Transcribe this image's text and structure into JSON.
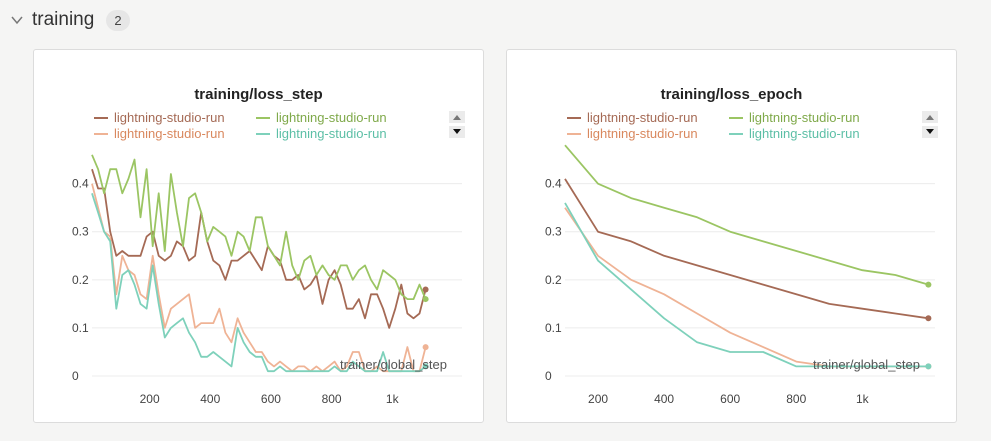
{
  "section": {
    "title": "training",
    "count": "2"
  },
  "colors": {
    "brown": "#a56a55",
    "green": "#9bc563",
    "peach": "#efb395",
    "teal": "#7ed1bb",
    "grid": "#ececec",
    "text": "#444444"
  },
  "chart_data": [
    {
      "type": "line",
      "title": "training/loss_step",
      "xlabel": "trainer/global_step",
      "xlim": [
        10,
        1230
      ],
      "ylim": [
        0,
        0.47
      ],
      "xticks": [
        200,
        400,
        600,
        800,
        1000
      ],
      "xtick_labels": [
        "200",
        "400",
        "600",
        "800",
        "1k"
      ],
      "yticks": [
        0,
        0.1,
        0.2,
        0.3,
        0.4
      ],
      "ytick_labels": [
        "0",
        "0.1",
        "0.2",
        "0.3",
        "0.4"
      ],
      "legend_position": "top",
      "series": [
        {
          "name": "lightning-studio-run",
          "color": "#a56a55",
          "end_marker": true,
          "x": [
            10,
            30,
            50,
            70,
            90,
            110,
            130,
            150,
            170,
            190,
            210,
            230,
            250,
            270,
            290,
            310,
            330,
            350,
            370,
            390,
            410,
            430,
            450,
            470,
            490,
            510,
            530,
            550,
            570,
            590,
            610,
            630,
            650,
            670,
            690,
            710,
            730,
            750,
            770,
            790,
            810,
            830,
            850,
            870,
            890,
            910,
            930,
            950,
            970,
            990,
            1010,
            1030,
            1050,
            1070,
            1090,
            1110,
            1130,
            1150,
            1170,
            1190,
            1210,
            1230
          ],
          "y": [
            0.43,
            0.39,
            0.39,
            0.3,
            0.25,
            0.26,
            0.25,
            0.25,
            0.25,
            0.29,
            0.3,
            0.25,
            0.24,
            0.25,
            0.28,
            0.27,
            0.24,
            0.25,
            0.34,
            0.28,
            0.24,
            0.23,
            0.2,
            0.24,
            0.24,
            0.25,
            0.26,
            0.24,
            0.22,
            0.27,
            0.25,
            0.24,
            0.2,
            0.2,
            0.21,
            0.18,
            0.19,
            0.21,
            0.15,
            0.2,
            0.22,
            0.19,
            0.14,
            0.14,
            0.16,
            0.12,
            0.17,
            0.17,
            0.14,
            0.1,
            0.14,
            0.19,
            0.13,
            0.12,
            0.13,
            0.18,
            null,
            null,
            null,
            null,
            null,
            null
          ]
        },
        {
          "name": "lightning-studio-run",
          "color": "#9bc563",
          "end_marker": true,
          "x": [
            10,
            30,
            50,
            70,
            90,
            110,
            130,
            150,
            170,
            190,
            210,
            230,
            250,
            270,
            290,
            310,
            330,
            350,
            370,
            390,
            410,
            430,
            450,
            470,
            490,
            510,
            530,
            550,
            570,
            590,
            610,
            630,
            650,
            670,
            690,
            710,
            730,
            750,
            770,
            790,
            810,
            830,
            850,
            870,
            890,
            910,
            930,
            950,
            970,
            990,
            1010,
            1030,
            1050,
            1070,
            1090,
            1110,
            1130,
            1150,
            1170,
            1190,
            1210,
            1230
          ],
          "y": [
            0.46,
            0.43,
            0.38,
            0.43,
            0.43,
            0.38,
            0.41,
            0.45,
            0.33,
            0.43,
            0.27,
            0.38,
            0.26,
            0.42,
            0.34,
            0.27,
            0.37,
            0.38,
            0.34,
            0.28,
            0.31,
            0.3,
            0.29,
            0.25,
            0.3,
            0.29,
            0.26,
            0.33,
            0.33,
            0.27,
            0.25,
            0.23,
            0.3,
            0.23,
            0.2,
            0.24,
            0.25,
            0.21,
            0.23,
            0.21,
            0.2,
            0.23,
            0.23,
            0.2,
            0.22,
            0.23,
            0.2,
            0.18,
            0.22,
            0.21,
            0.2,
            0.17,
            0.16,
            0.16,
            0.19,
            0.16,
            null,
            null,
            null,
            null,
            null,
            null
          ]
        },
        {
          "name": "lightning-studio-run",
          "color": "#efb395",
          "end_marker": true,
          "x": [
            10,
            30,
            50,
            70,
            90,
            110,
            130,
            150,
            170,
            190,
            210,
            230,
            250,
            270,
            290,
            310,
            330,
            350,
            370,
            390,
            410,
            430,
            450,
            470,
            490,
            510,
            530,
            550,
            570,
            590,
            610,
            630,
            650,
            670,
            690,
            710,
            730,
            750,
            770,
            790,
            810,
            830,
            850,
            870,
            890,
            910,
            930,
            950,
            970,
            990,
            1010,
            1030,
            1050,
            1070,
            1090,
            1110,
            1130,
            1150,
            1170,
            1190,
            1210,
            1230
          ],
          "y": [
            0.4,
            0.35,
            0.3,
            0.29,
            0.17,
            0.25,
            0.22,
            0.21,
            0.17,
            0.16,
            0.25,
            0.17,
            0.1,
            0.14,
            0.15,
            0.16,
            0.17,
            0.1,
            0.11,
            0.11,
            0.11,
            0.14,
            0.09,
            0.07,
            0.12,
            0.09,
            0.07,
            0.05,
            0.05,
            0.03,
            0.02,
            0.03,
            0.02,
            0.01,
            0.02,
            0.02,
            0.01,
            0.02,
            0.01,
            0.02,
            0.03,
            0.01,
            0.02,
            0.05,
            0.05,
            0.01,
            0.01,
            0.02,
            0.01,
            0.01,
            0.01,
            0.01,
            0.06,
            0.01,
            0.01,
            0.06,
            null,
            null,
            null,
            null,
            null,
            null
          ]
        },
        {
          "name": "lightning-studio-run",
          "color": "#7ed1bb",
          "end_marker": true,
          "x": [
            10,
            30,
            50,
            70,
            90,
            110,
            130,
            150,
            170,
            190,
            210,
            230,
            250,
            270,
            290,
            310,
            330,
            350,
            370,
            390,
            410,
            430,
            450,
            470,
            490,
            510,
            530,
            550,
            570,
            590,
            610,
            630,
            650,
            670,
            690,
            710,
            730,
            750,
            770,
            790,
            810,
            830,
            850,
            870,
            890,
            910,
            930,
            950,
            970,
            990,
            1010,
            1030,
            1050,
            1070,
            1090,
            1110,
            1130,
            1150,
            1170,
            1190,
            1210,
            1230
          ],
          "y": [
            0.38,
            0.34,
            0.3,
            0.28,
            0.14,
            0.21,
            0.22,
            0.19,
            0.15,
            0.14,
            0.23,
            0.15,
            0.08,
            0.1,
            0.11,
            0.12,
            0.09,
            0.07,
            0.04,
            0.04,
            0.05,
            0.04,
            0.03,
            0.02,
            0.1,
            0.07,
            0.05,
            0.04,
            0.04,
            0.01,
            0.01,
            0.02,
            0.01,
            0.01,
            0.01,
            0.01,
            0.01,
            0.01,
            0.01,
            0.01,
            0.02,
            0.01,
            0.01,
            0.03,
            0.02,
            0.01,
            0.01,
            0.01,
            0.05,
            0.01,
            0.01,
            0.01,
            0.01,
            0.01,
            0.01,
            0.02,
            null,
            null,
            null,
            null,
            null,
            null
          ]
        }
      ]
    },
    {
      "type": "line",
      "title": "training/loss_epoch",
      "xlabel": "trainer/global_step",
      "xlim": [
        100,
        1220
      ],
      "ylim": [
        0,
        0.47
      ],
      "xticks": [
        200,
        400,
        600,
        800,
        1000
      ],
      "xtick_labels": [
        "200",
        "400",
        "600",
        "800",
        "1k"
      ],
      "yticks": [
        0,
        0.1,
        0.2,
        0.3,
        0.4
      ],
      "ytick_labels": [
        "0",
        "0.1",
        "0.2",
        "0.3",
        "0.4"
      ],
      "legend_position": "top",
      "series": [
        {
          "name": "lightning-studio-run",
          "color": "#a56a55",
          "end_marker": true,
          "x": [
            100,
            200,
            300,
            400,
            500,
            600,
            700,
            800,
            900,
            1000,
            1100,
            1200
          ],
          "y": [
            0.41,
            0.3,
            0.28,
            0.25,
            0.23,
            0.21,
            0.19,
            0.17,
            0.15,
            0.14,
            0.13,
            0.12
          ]
        },
        {
          "name": "lightning-studio-run",
          "color": "#9bc563",
          "end_marker": true,
          "x": [
            100,
            200,
            300,
            400,
            500,
            600,
            700,
            800,
            900,
            1000,
            1100,
            1200
          ],
          "y": [
            0.48,
            0.4,
            0.37,
            0.35,
            0.33,
            0.3,
            0.28,
            0.26,
            0.24,
            0.22,
            0.21,
            0.19
          ]
        },
        {
          "name": "lightning-studio-run",
          "color": "#efb395",
          "end_marker": true,
          "x": [
            100,
            200,
            300,
            400,
            500,
            600,
            700,
            800,
            900,
            1000,
            1100,
            1200
          ],
          "y": [
            0.35,
            0.25,
            0.2,
            0.17,
            0.13,
            0.09,
            0.06,
            0.03,
            0.02,
            0.02,
            0.02,
            0.02
          ]
        },
        {
          "name": "lightning-studio-run",
          "color": "#7ed1bb",
          "end_marker": true,
          "x": [
            100,
            200,
            300,
            400,
            500,
            600,
            700,
            800,
            900,
            1000,
            1100,
            1200
          ],
          "y": [
            0.36,
            0.24,
            0.18,
            0.12,
            0.07,
            0.05,
            0.05,
            0.02,
            0.02,
            0.02,
            0.02,
            0.02
          ]
        }
      ]
    }
  ]
}
